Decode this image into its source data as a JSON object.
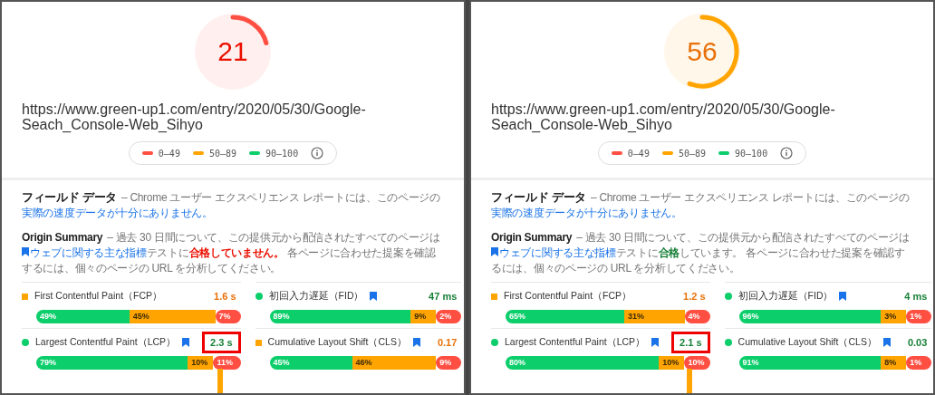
{
  "panels": [
    {
      "score": {
        "value": "21",
        "color": "#ff4e42"
      },
      "url": "https://www.green-up1.com/entry/2020/05/30/Google-Seach_Console-Web_Sihyo",
      "legend": [
        {
          "label": "0–49",
          "color": "#ff4e42"
        },
        {
          "label": "50–89",
          "color": "#ffa400"
        },
        {
          "label": "90–100",
          "color": "#0cce6b"
        }
      ],
      "field_data": {
        "title": "フィールド データ",
        "text": "– Chrome ユーザー エクスペリエンス レポートには、このページの",
        "link": "実際の速度データが十分にありません。"
      },
      "origin_summary": {
        "title": "Origin Summary",
        "text": "– 過去 30 日間について、この提供元から配信されたすべてのページは",
        "link": "ウェブに関する主な指標",
        "text_2": "テストに",
        "verdict": "合格していません。",
        "passed": false,
        "text_3": " 各ページに合わせた提案を確認するには、個々のページの URL を分析してください。"
      },
      "metrics": [
        {
          "name": "First Contentful Paint（FCP）",
          "kind": "average",
          "bookmark": false,
          "value": "1.6 s",
          "highlighted": false,
          "distribution": [
            {
              "label": "49%"
            },
            {
              "label": "45%"
            },
            {
              "label": "7%"
            }
          ]
        },
        {
          "name": "初回入力遅延（FID）",
          "kind": "good",
          "bookmark": true,
          "value": "47 ms",
          "highlighted": false,
          "distribution": [
            {
              "label": "89%"
            },
            {
              "label": "9%"
            },
            {
              "label": "2%"
            }
          ]
        },
        {
          "name": "Largest Contentful Paint（LCP）",
          "kind": "good",
          "bookmark": true,
          "value": "2.3 s",
          "highlighted": true,
          "distribution": [
            {
              "label": "79%"
            },
            {
              "label": "10%"
            },
            {
              "label": "11%"
            }
          ],
          "marker": {
            "level": 0.885
          }
        },
        {
          "name": "Cumulative Layout Shift（CLS）",
          "kind": "average",
          "bookmark": true,
          "value": "0.17",
          "highlighted": false,
          "distribution": [
            {
              "label": "45%"
            },
            {
              "label": "46%"
            },
            {
              "label": "9%"
            }
          ]
        }
      ]
    },
    {
      "score": {
        "value": "56",
        "color": "#ffa400"
      },
      "url": "https://www.green-up1.com/entry/2020/05/30/Google-Seach_Console-Web_Sihyo",
      "legend": [
        {
          "label": "0–49",
          "color": "#ff4e42"
        },
        {
          "label": "50–89",
          "color": "#ffa400"
        },
        {
          "label": "90–100",
          "color": "#0cce6b"
        }
      ],
      "field_data": {
        "title": "フィールド データ",
        "text": "– Chrome ユーザー エクスペリエンス レポートには、このページの",
        "link": "実際の速度データが十分にありません。"
      },
      "origin_summary": {
        "title": "Origin Summary",
        "text": "– 過去 30 日間について、この提供元から配信されたすべてのページは",
        "link": "ウェブに関する主な指標",
        "text_2": "テストに",
        "verdict": "合格",
        "passed": true,
        "text_3": "しています。 各ページに合わせた提案を確認するには、個々のページの URL を分析してください。"
      },
      "metrics": [
        {
          "name": "First Contentful Paint（FCP）",
          "kind": "average",
          "bookmark": false,
          "value": "1.2 s",
          "highlighted": false,
          "distribution": [
            {
              "label": "65%"
            },
            {
              "label": "31%"
            },
            {
              "label": "4%"
            }
          ]
        },
        {
          "name": "初回入力遅延（FID）",
          "kind": "good",
          "bookmark": true,
          "value": "4 ms",
          "highlighted": false,
          "distribution": [
            {
              "label": "96%"
            },
            {
              "label": "3%"
            },
            {
              "label": "1%"
            }
          ]
        },
        {
          "name": "Largest Contentful Paint（LCP）",
          "kind": "good",
          "bookmark": true,
          "value": "2.1 s",
          "highlighted": true,
          "distribution": [
            {
              "label": "80%"
            },
            {
              "label": "10%"
            },
            {
              "label": "10%"
            }
          ],
          "marker": {
            "level": 0.885
          }
        },
        {
          "name": "Cumulative Layout Shift（CLS）",
          "kind": "good",
          "bookmark": true,
          "value": "0.03",
          "highlighted": false,
          "distribution": [
            {
              "label": "91%"
            },
            {
              "label": "8%"
            },
            {
              "label": "1%"
            }
          ]
        }
      ]
    }
  ]
}
